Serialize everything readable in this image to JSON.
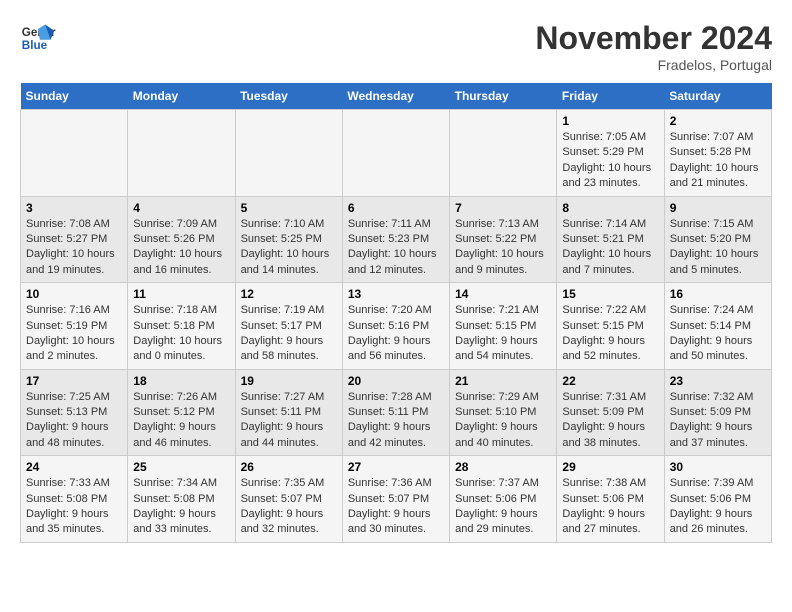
{
  "header": {
    "logo_line1": "General",
    "logo_line2": "Blue",
    "month": "November 2024",
    "location": "Fradelos, Portugal"
  },
  "days_of_week": [
    "Sunday",
    "Monday",
    "Tuesday",
    "Wednesday",
    "Thursday",
    "Friday",
    "Saturday"
  ],
  "weeks": [
    [
      {
        "day": "",
        "info": ""
      },
      {
        "day": "",
        "info": ""
      },
      {
        "day": "",
        "info": ""
      },
      {
        "day": "",
        "info": ""
      },
      {
        "day": "",
        "info": ""
      },
      {
        "day": "1",
        "info": "Sunrise: 7:05 AM\nSunset: 5:29 PM\nDaylight: 10 hours and 23 minutes."
      },
      {
        "day": "2",
        "info": "Sunrise: 7:07 AM\nSunset: 5:28 PM\nDaylight: 10 hours and 21 minutes."
      }
    ],
    [
      {
        "day": "3",
        "info": "Sunrise: 7:08 AM\nSunset: 5:27 PM\nDaylight: 10 hours and 19 minutes."
      },
      {
        "day": "4",
        "info": "Sunrise: 7:09 AM\nSunset: 5:26 PM\nDaylight: 10 hours and 16 minutes."
      },
      {
        "day": "5",
        "info": "Sunrise: 7:10 AM\nSunset: 5:25 PM\nDaylight: 10 hours and 14 minutes."
      },
      {
        "day": "6",
        "info": "Sunrise: 7:11 AM\nSunset: 5:23 PM\nDaylight: 10 hours and 12 minutes."
      },
      {
        "day": "7",
        "info": "Sunrise: 7:13 AM\nSunset: 5:22 PM\nDaylight: 10 hours and 9 minutes."
      },
      {
        "day": "8",
        "info": "Sunrise: 7:14 AM\nSunset: 5:21 PM\nDaylight: 10 hours and 7 minutes."
      },
      {
        "day": "9",
        "info": "Sunrise: 7:15 AM\nSunset: 5:20 PM\nDaylight: 10 hours and 5 minutes."
      }
    ],
    [
      {
        "day": "10",
        "info": "Sunrise: 7:16 AM\nSunset: 5:19 PM\nDaylight: 10 hours and 2 minutes."
      },
      {
        "day": "11",
        "info": "Sunrise: 7:18 AM\nSunset: 5:18 PM\nDaylight: 10 hours and 0 minutes."
      },
      {
        "day": "12",
        "info": "Sunrise: 7:19 AM\nSunset: 5:17 PM\nDaylight: 9 hours and 58 minutes."
      },
      {
        "day": "13",
        "info": "Sunrise: 7:20 AM\nSunset: 5:16 PM\nDaylight: 9 hours and 56 minutes."
      },
      {
        "day": "14",
        "info": "Sunrise: 7:21 AM\nSunset: 5:15 PM\nDaylight: 9 hours and 54 minutes."
      },
      {
        "day": "15",
        "info": "Sunrise: 7:22 AM\nSunset: 5:15 PM\nDaylight: 9 hours and 52 minutes."
      },
      {
        "day": "16",
        "info": "Sunrise: 7:24 AM\nSunset: 5:14 PM\nDaylight: 9 hours and 50 minutes."
      }
    ],
    [
      {
        "day": "17",
        "info": "Sunrise: 7:25 AM\nSunset: 5:13 PM\nDaylight: 9 hours and 48 minutes."
      },
      {
        "day": "18",
        "info": "Sunrise: 7:26 AM\nSunset: 5:12 PM\nDaylight: 9 hours and 46 minutes."
      },
      {
        "day": "19",
        "info": "Sunrise: 7:27 AM\nSunset: 5:11 PM\nDaylight: 9 hours and 44 minutes."
      },
      {
        "day": "20",
        "info": "Sunrise: 7:28 AM\nSunset: 5:11 PM\nDaylight: 9 hours and 42 minutes."
      },
      {
        "day": "21",
        "info": "Sunrise: 7:29 AM\nSunset: 5:10 PM\nDaylight: 9 hours and 40 minutes."
      },
      {
        "day": "22",
        "info": "Sunrise: 7:31 AM\nSunset: 5:09 PM\nDaylight: 9 hours and 38 minutes."
      },
      {
        "day": "23",
        "info": "Sunrise: 7:32 AM\nSunset: 5:09 PM\nDaylight: 9 hours and 37 minutes."
      }
    ],
    [
      {
        "day": "24",
        "info": "Sunrise: 7:33 AM\nSunset: 5:08 PM\nDaylight: 9 hours and 35 minutes."
      },
      {
        "day": "25",
        "info": "Sunrise: 7:34 AM\nSunset: 5:08 PM\nDaylight: 9 hours and 33 minutes."
      },
      {
        "day": "26",
        "info": "Sunrise: 7:35 AM\nSunset: 5:07 PM\nDaylight: 9 hours and 32 minutes."
      },
      {
        "day": "27",
        "info": "Sunrise: 7:36 AM\nSunset: 5:07 PM\nDaylight: 9 hours and 30 minutes."
      },
      {
        "day": "28",
        "info": "Sunrise: 7:37 AM\nSunset: 5:06 PM\nDaylight: 9 hours and 29 minutes."
      },
      {
        "day": "29",
        "info": "Sunrise: 7:38 AM\nSunset: 5:06 PM\nDaylight: 9 hours and 27 minutes."
      },
      {
        "day": "30",
        "info": "Sunrise: 7:39 AM\nSunset: 5:06 PM\nDaylight: 9 hours and 26 minutes."
      }
    ]
  ]
}
